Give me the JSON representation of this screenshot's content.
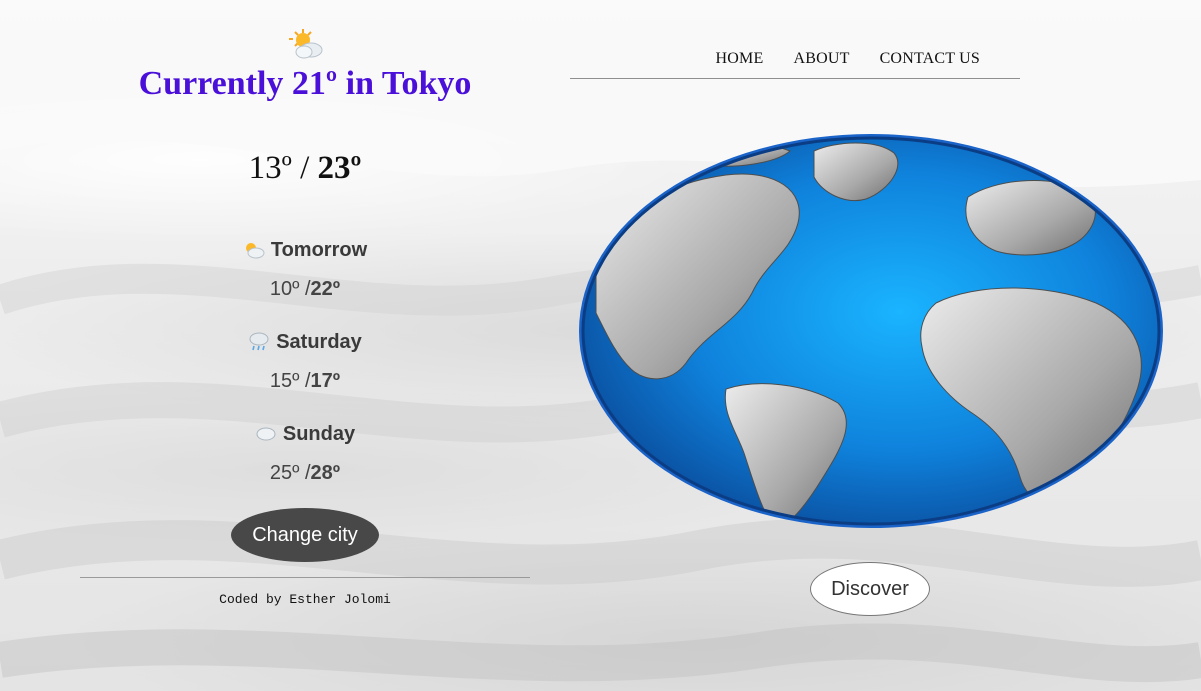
{
  "header": {
    "weather_icon": "sun-behind-cloud-icon",
    "title": "Currently 21º in Tokyo"
  },
  "today": {
    "low": "13º",
    "separator": " / ",
    "high": "23º"
  },
  "forecast": [
    {
      "icon": "sun-behind-cloud-icon",
      "day": "Tomorrow",
      "low": "10º /",
      "high": "22º"
    },
    {
      "icon": "snow-rain-cloud-icon",
      "day": "Saturday",
      "low": "15º /",
      "high": "17º"
    },
    {
      "icon": "cloud-icon",
      "day": "Sunday",
      "low": "25º /",
      "high": "28º"
    }
  ],
  "actions": {
    "change_city": "Change city",
    "discover": "Discover"
  },
  "footer": {
    "credit": "Coded by Esther Jolomi"
  },
  "nav": {
    "items": [
      "HOME",
      "ABOUT",
      "CONTACT US"
    ]
  },
  "colors": {
    "title": "#4a0fd8",
    "ocean": "#1487e6",
    "button_dark": "#484848"
  }
}
